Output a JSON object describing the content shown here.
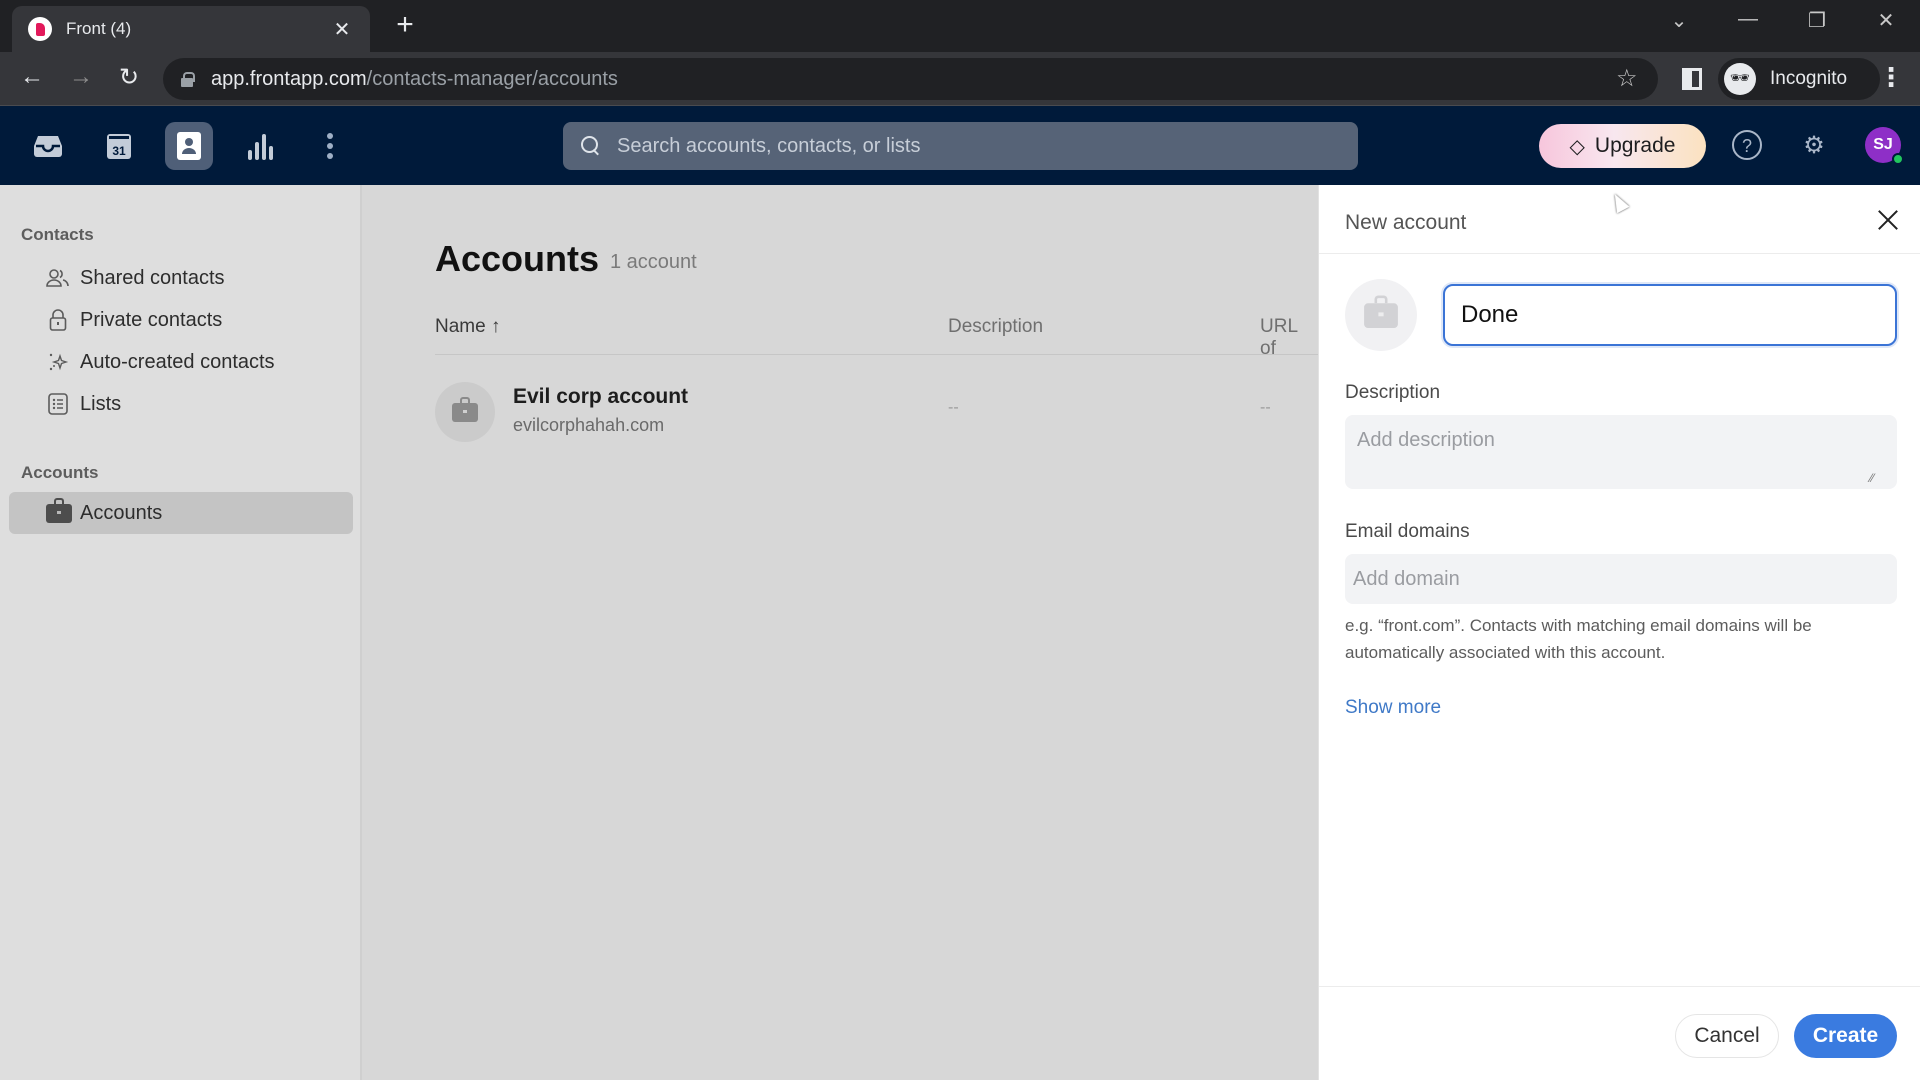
{
  "browser": {
    "tab_title": "Front (4)",
    "url_host": "app.frontapp.com",
    "url_path": "/contacts-manager/accounts",
    "profile_label": "Incognito"
  },
  "header": {
    "nav_icons": [
      "inbox-icon",
      "calendar-icon",
      "contacts-icon",
      "analytics-icon",
      "more-icon"
    ],
    "calendar_day": "31",
    "search_placeholder": "Search accounts, contacts, or lists",
    "upgrade_label": "Upgrade",
    "avatar_initials": "SJ"
  },
  "sidebar": {
    "contacts_heading": "Contacts",
    "contacts_items": [
      {
        "label": "Shared contacts",
        "icon": "users-icon"
      },
      {
        "label": "Private contacts",
        "icon": "lock-icon"
      },
      {
        "label": "Auto-created contacts",
        "icon": "sparkle-icon"
      },
      {
        "label": "Lists",
        "icon": "list-icon"
      }
    ],
    "accounts_heading": "Accounts",
    "accounts_items": [
      {
        "label": "Accounts",
        "icon": "briefcase-icon",
        "active": true
      }
    ]
  },
  "main": {
    "title": "Accounts",
    "count": "1 account",
    "columns": [
      "Name ↑",
      "Description",
      "URL of"
    ],
    "rows": [
      {
        "name": "Evil corp account",
        "domain": "evilcorphahah.com",
        "description": "--",
        "url": "--"
      }
    ]
  },
  "drawer": {
    "title": "New account",
    "name_value": "Done ",
    "description_label": "Description",
    "description_placeholder": "Add description",
    "email_domains_label": "Email domains",
    "domain_placeholder": "Add domain",
    "hint": "e.g. “front.com”. Contacts with matching email domains will be automatically associated with this account.",
    "show_more": "Show more",
    "cancel_label": "Cancel",
    "create_label": "Create"
  },
  "colors": {
    "header_bg": "#001a3a",
    "accent": "#3a7be0",
    "link": "#3f79c7",
    "avatar_bg": "#8e2fc7",
    "online": "#22c55e"
  }
}
